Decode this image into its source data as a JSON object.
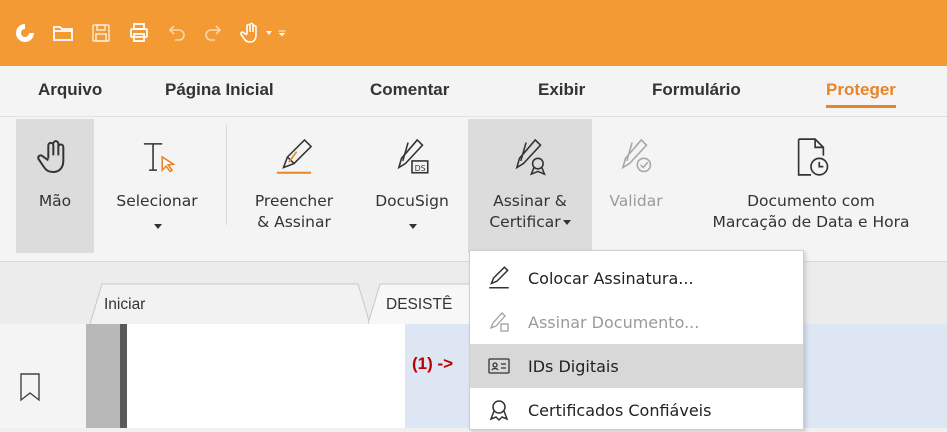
{
  "menu_tabs": [
    "Arquivo",
    "Página Inicial",
    "Comentar",
    "Exibir",
    "Formulário",
    "Proteger"
  ],
  "active_tab": "Proteger",
  "ribbon": {
    "hand": {
      "label": "Mão"
    },
    "select": {
      "label": "Selecionar"
    },
    "fill_sign": {
      "label1": "Preencher",
      "label2": "& Assinar"
    },
    "docusign": {
      "label": "DocuSign"
    },
    "sign_certify": {
      "label1": "Assinar &",
      "label2": "Certificar"
    },
    "validate": {
      "label": "Validar"
    },
    "timestamp": {
      "label1": "Documento com",
      "label2": "Marcação de Data e Hora"
    }
  },
  "doc_tabs": [
    "Iniciar",
    "DESISTÊ"
  ],
  "dropdown": {
    "items": [
      {
        "label": "Colocar Assinatura...",
        "enabled": true
      },
      {
        "label": "Assinar Documento...",
        "enabled": false
      },
      {
        "label": "IDs Digitais",
        "enabled": true
      },
      {
        "label": "Certificados Confiáveis",
        "enabled": true
      }
    ]
  },
  "annotation": "(1) ->",
  "colors": {
    "titlebar": "#f39a35",
    "accent": "#e8842a",
    "annotation": "#c00000"
  }
}
